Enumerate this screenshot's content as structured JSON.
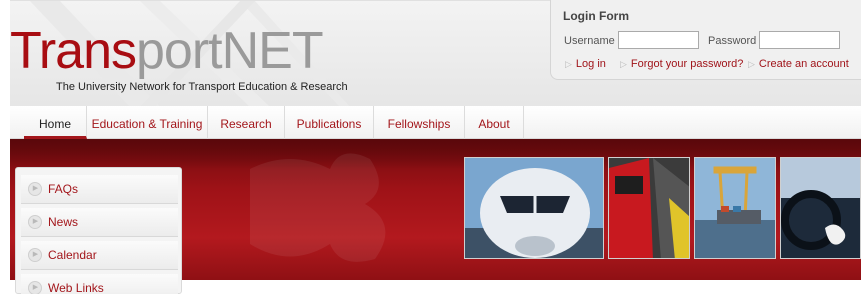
{
  "site": {
    "logo_part1": "Trans",
    "logo_part2": "portNET",
    "tagline": "The University Network for Transport Education & Research"
  },
  "login": {
    "title": "Login Form",
    "username_label": "Username",
    "username_value": "",
    "password_label": "Password",
    "password_value": "",
    "links": [
      "Log in",
      "Forgot your password?",
      "Create an account"
    ]
  },
  "nav": {
    "items": [
      "Home",
      "Education & Training",
      "Research",
      "Publications",
      "Fellowships",
      "About"
    ],
    "active": "Home"
  },
  "sidebar": {
    "items": [
      "FAQs",
      "News",
      "Calendar",
      "Web Links"
    ]
  },
  "banner": {
    "photos": [
      "airplane-photo",
      "train-photo",
      "port-cranes-photo",
      "car-dashboard-photo"
    ]
  },
  "colors": {
    "brand_red": "#a3161b",
    "banner_red": "#b3191e",
    "logo_gray": "#9a9a9a"
  }
}
